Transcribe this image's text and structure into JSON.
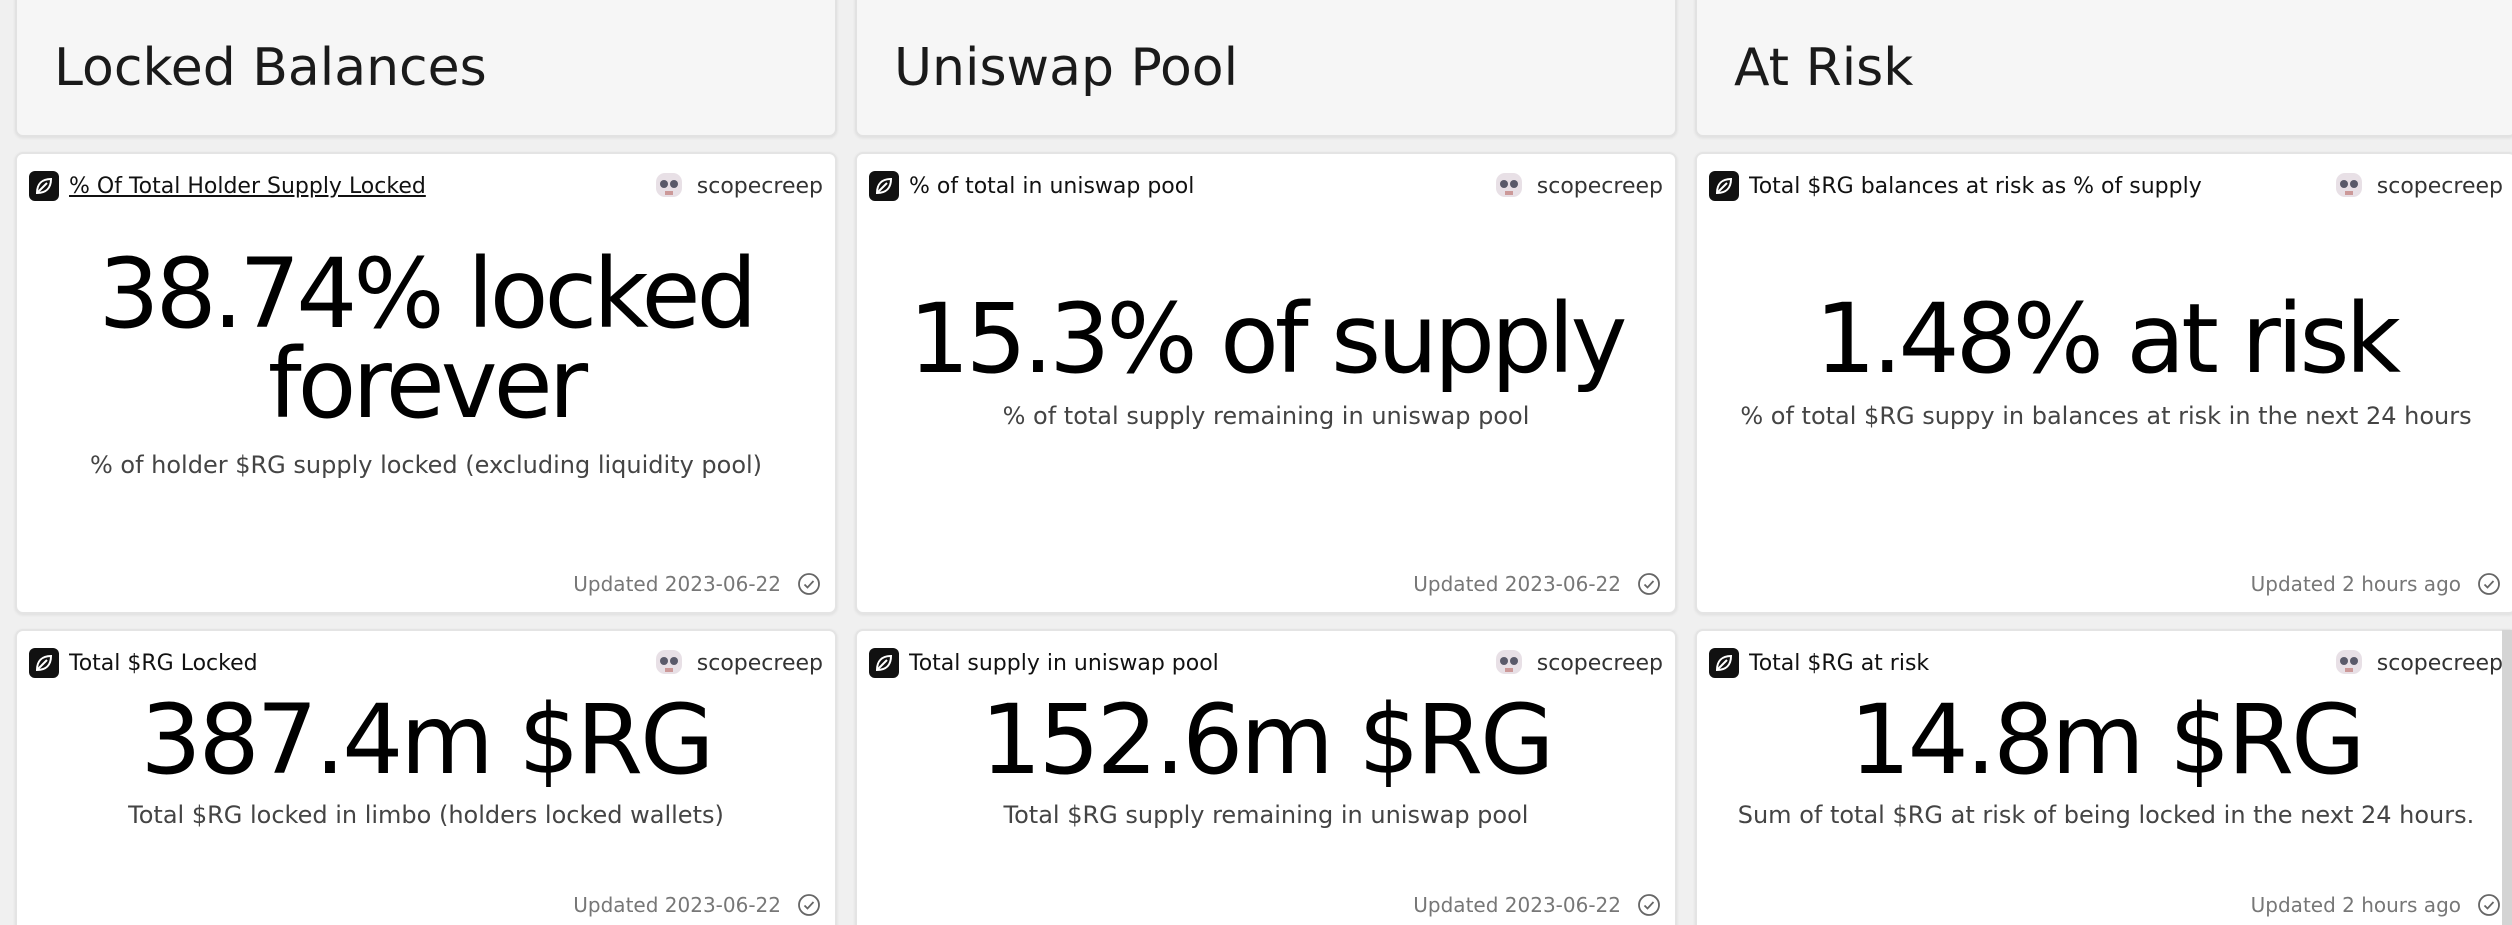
{
  "sections": [
    {
      "title": "Locked Balances",
      "cards": [
        {
          "title": "% Of Total Holder Supply Locked",
          "owner": "scopecreep",
          "value_line1": "38.74% locked",
          "value_line2": "forever",
          "description": "% of holder $RG supply locked (excluding liquidity pool)",
          "updated": "Updated 2023-06-22"
        },
        {
          "title": "Total $RG Locked",
          "owner": "scopecreep",
          "value": "387.4m $RG",
          "description": "Total $RG locked in limbo (holders locked wallets)",
          "updated": "Updated 2023-06-22"
        }
      ]
    },
    {
      "title": "Uniswap Pool",
      "cards": [
        {
          "title": "% of total in uniswap pool",
          "owner": "scopecreep",
          "value": "15.3% of supply",
          "description": "% of total supply remaining in uniswap pool",
          "updated": "Updated 2023-06-22"
        },
        {
          "title": "Total supply in uniswap pool",
          "owner": "scopecreep",
          "value": "152.6m $RG",
          "description": "Total $RG supply remaining in uniswap pool",
          "updated": "Updated 2023-06-22"
        }
      ]
    },
    {
      "title": "At Risk",
      "cards": [
        {
          "title": "Total $RG balances at risk as % of supply",
          "owner": "scopecreep",
          "value": "1.48% at risk",
          "description": "% of total $RG suppy in balances at risk in the next 24 hours",
          "updated": "Updated 2 hours ago"
        },
        {
          "title": "Total $RG at risk",
          "owner": "scopecreep",
          "value": "14.8m $RG",
          "description": "Sum of total $RG at risk of being locked in the next 24 hours.",
          "updated": "Updated 2 hours ago"
        }
      ]
    }
  ],
  "icons": {
    "brand": "leaf-logo-icon",
    "avatar": "skull-avatar-icon",
    "status": "check-circle-icon"
  },
  "colors": {
    "background": "#f0f0f0",
    "card": "#ffffff",
    "header": "#f6f6f6",
    "text": "#111111"
  }
}
